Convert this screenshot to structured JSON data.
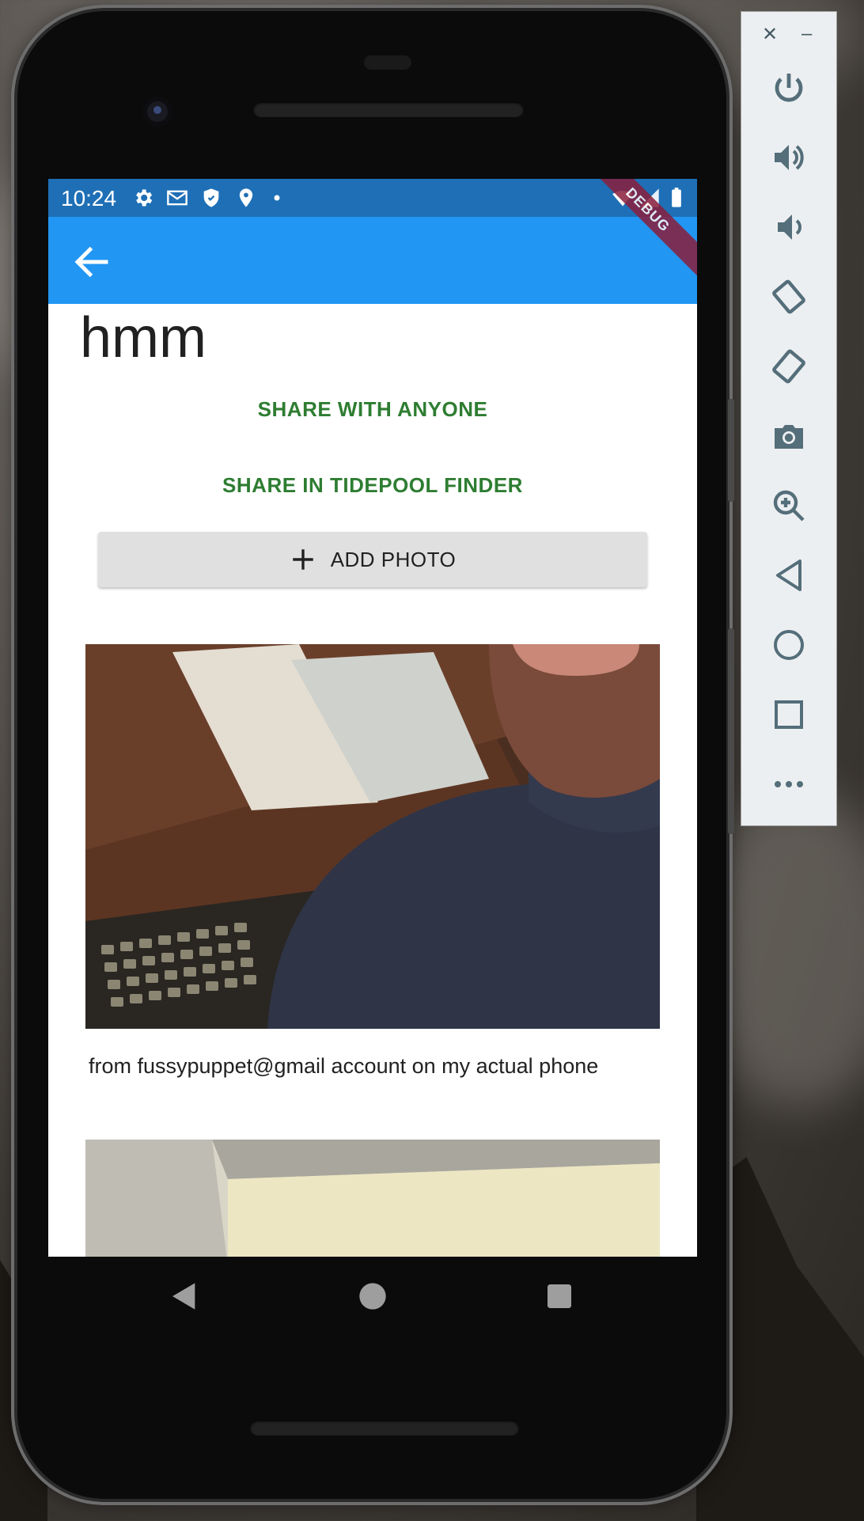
{
  "status_bar": {
    "time": "10:24",
    "icons": [
      "settings-icon",
      "gmail-icon",
      "shield-icon",
      "location-icon",
      "dot-icon",
      "wifi-icon",
      "signal-icon",
      "battery-icon"
    ]
  },
  "app_bar": {
    "back_icon": "arrow-back-icon",
    "debug_banner": "DEBUG"
  },
  "content": {
    "title": "hmm",
    "share_anyone_label": "SHARE WITH ANYONE",
    "share_tidepool_label": "SHARE IN TIDEPOOL FINDER",
    "add_photo_label": "ADD PHOTO",
    "photos": [
      {
        "caption": "from fussypuppet@gmail account on my actual phone"
      },
      {
        "caption": ""
      }
    ]
  },
  "nav_bar": [
    "back-triangle-icon",
    "home-circle-icon",
    "recents-square-icon"
  ],
  "emulator_toolbar": {
    "close": "✕",
    "minimize": "–",
    "buttons": [
      "power-icon",
      "volume-up-icon",
      "volume-down-icon",
      "rotate-left-icon",
      "rotate-right-icon",
      "camera-icon",
      "zoom-icon",
      "back-icon",
      "home-icon",
      "overview-icon",
      "more-icon"
    ]
  },
  "colors": {
    "status_bar": "#1e6fb6",
    "app_bar": "#2196f3",
    "text_button": "#2e7d32",
    "debug_banner": "#8a1e3c"
  }
}
